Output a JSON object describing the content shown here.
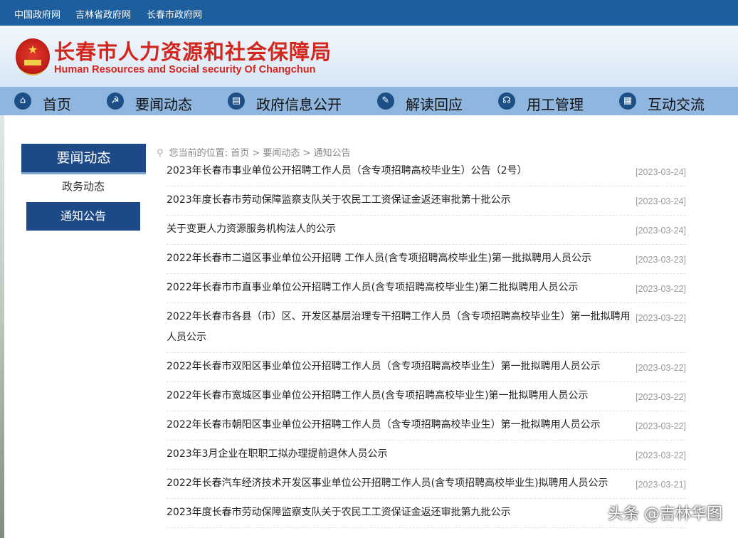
{
  "topbar": {
    "links": [
      "中国政府网",
      "吉林省政府网",
      "长春市政府网"
    ]
  },
  "header": {
    "title": "长春市人力资源和社会保障局",
    "subtitle": "Human Resources and Social security Of Changchun"
  },
  "nav": {
    "items": [
      {
        "label": "首页",
        "icon": "home-icon"
      },
      {
        "label": "要闻动态",
        "icon": "news-icon"
      },
      {
        "label": "政府信息公开",
        "icon": "document-icon"
      },
      {
        "label": "解读回应",
        "icon": "interpret-icon"
      },
      {
        "label": "用工管理",
        "icon": "headset-icon"
      },
      {
        "label": "互动交流",
        "icon": "building-icon"
      }
    ]
  },
  "sidebar": {
    "heading": "要闻动态",
    "items": [
      "政务动态",
      "通知公告"
    ],
    "active": "通知公告"
  },
  "breadcrumb": {
    "prefix": "您当前的位置:",
    "items": [
      "首页",
      "要闻动态",
      "通知公告"
    ],
    "separator": ">"
  },
  "articles": [
    {
      "title": "2023年长春市事业单位公开招聘工作人员（含专项招聘高校毕业生）公告（2号）",
      "date": "[2023-03-24]"
    },
    {
      "title": "2023年度长春市劳动保障监察支队关于农民工工资保证金返还审批第十批公示",
      "date": "[2023-03-24]"
    },
    {
      "title": "关于变更人力资源服务机构法人的公示",
      "date": "[2023-03-24]"
    },
    {
      "title": "2022年长春市二道区事业单位公开招聘 工作人员(含专项招聘高校毕业生)第一批拟聘用人员公示",
      "date": "[2023-03-23]"
    },
    {
      "title": "2022年长春市市直事业单位公开招聘工作人员(含专项招聘高校毕业生)第二批拟聘用人员公示",
      "date": "[2023-03-22]"
    },
    {
      "title": "2022年长春市各县（市）区、开发区基层治理专干招聘工作人员（含专项招聘高校毕业生）第一批拟聘用人员公示",
      "date": "[2023-03-22]"
    },
    {
      "title": "2022年长春市双阳区事业单位公开招聘工作人员（含专项招聘高校毕业生）第一批拟聘用人员公示",
      "date": "[2023-03-22]"
    },
    {
      "title": "2022年长春市宽城区事业单位公开招聘工作人员(含专项招聘高校毕业生)第一批拟聘用人员公示",
      "date": "[2023-03-22]"
    },
    {
      "title": "2022年长春市朝阳区事业单位公开招聘工作人员（含专项招聘高校毕业生）第一批拟聘用人员公示",
      "date": "[2023-03-22]"
    },
    {
      "title": "2023年3月企业在职职工拟办理提前退休人员公示",
      "date": "[2023-03-22]"
    },
    {
      "title": "2022年长春汽车经济技术开发区事业单位公开招聘工作人员(含专项招聘高校毕业生)拟聘用人员公示",
      "date": "[2023-03-21]"
    },
    {
      "title": "2023年度长春市劳动保障监察支队关于农民工工资保证金返还审批第九批公示",
      "date": ""
    }
  ],
  "watermark": "头条 @吉林华图",
  "colors": {
    "topbar": "#1c5e9e",
    "nav": "#8fb6df",
    "accent": "#1d4a86",
    "title_red": "#d3261d"
  }
}
